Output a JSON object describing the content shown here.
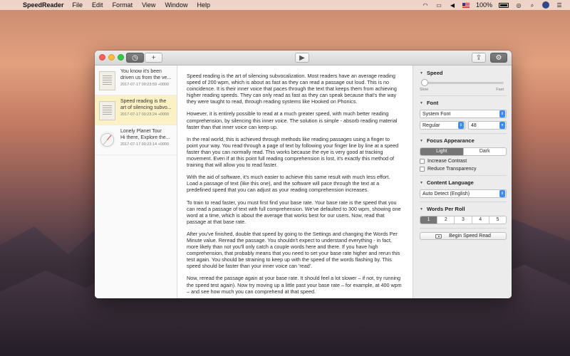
{
  "menubar": {
    "app_name": "SpeedReader",
    "menus": [
      "File",
      "Edit",
      "Format",
      "View",
      "Window",
      "Help"
    ],
    "battery_percent": "100%"
  },
  "toolbar": {
    "history_icon": "clock-icon",
    "add_icon": "plus-icon",
    "play_icon": "play-icon",
    "share_icon": "share-icon",
    "settings_icon": "gear-icon"
  },
  "documents": [
    {
      "title1": "You know it's been",
      "title2": "driven us from the ve...",
      "date": "2017-07-17 00:23:59 +0000"
    },
    {
      "title1": "Speed reading is the",
      "title2": "art of silencing subvo...",
      "date": "2017-07-17 00:23:24 +0000"
    },
    {
      "title1": "Lonely Planet Tour",
      "title2": "Hi there, Explore the...",
      "date": "2017-07-17 00:23:14 +0000"
    }
  ],
  "article": [
    "Speed reading is the art of silencing subvocalization. Most readers have an average reading speed of 200 wpm, which is about as fast as they can read a passage out loud. This is no coincidence. It is their inner voice that paces through the text that keeps them from achieving higher reading speeds. They can only read as fast as they can speak because that's the way they were taught to read, through reading systems like Hooked on Phonics.",
    "However, it is entirely possible to read at a much greater speed, with much better reading comprehension, by silencing this inner voice. The solution is simple - absorb reading material faster than that inner voice can keep up.",
    "In the real world, this is achieved through methods like reading passages using a finger to point your way. You read through a page of text by following your finger line by line at a speed faster than you can normally read. This works because the eye is very good at tracking movement. Even if at this point full reading comprehension is lost, it's exactly this method of training that will allow you to read faster.",
    "With the aid of software, it's much easier to achieve this same result with much less effort. Load a passage of text (like this one), and the software will pace through the text at a predefined speed that you can adjust as your reading comprehension increases.",
    "To train to read faster, you must first find your base rate. Your base rate is the speed that you can read a passage of text with full comprehension. We've defaulted to 300 wpm, showing one word at a time, which is about the average that works best for our users. Now, read that passage at that base rate.",
    "After you've finished, double that speed by going to the Settings and changing the Words Per Minute value. Reread the passage. You shouldn't expect to understand everything - in fact, more likely than not you'll only catch a couple words here and there. If you have high comprehension, that probably means that you need to set your base rate higher and rerun this test again. You should be straining to keep up with the speed of the words flashing by. This speed should be faster than your inner voice can 'read'.",
    "Now, reread the passage again at your base rate. It should feel a lot slower – if not, try running the speed test again). Now try moving up a little past your base rate – for example, at 400 wpm – and see how much you can comprehend at that speed."
  ],
  "panel": {
    "speed": {
      "label": "Speed",
      "slow": "Slow",
      "fast": "Fast",
      "level": 0.02
    },
    "font": {
      "label": "Font",
      "family": "System Font",
      "style": "Regular",
      "size": "48"
    },
    "focus": {
      "label": "Focus Appearance",
      "light": "Light",
      "dark": "Dark",
      "selected": "Light",
      "increase_contrast": "Increase Contrast",
      "reduce_transparency": "Reduce Transparency"
    },
    "language": {
      "label": "Content Language",
      "value": "Auto Detect (English)"
    },
    "words_per_roll": {
      "label": "Words Per Roll",
      "options": [
        "1",
        "2",
        "3",
        "4",
        "5"
      ],
      "selected": "1"
    },
    "begin_button": "Begin Speed Read"
  }
}
